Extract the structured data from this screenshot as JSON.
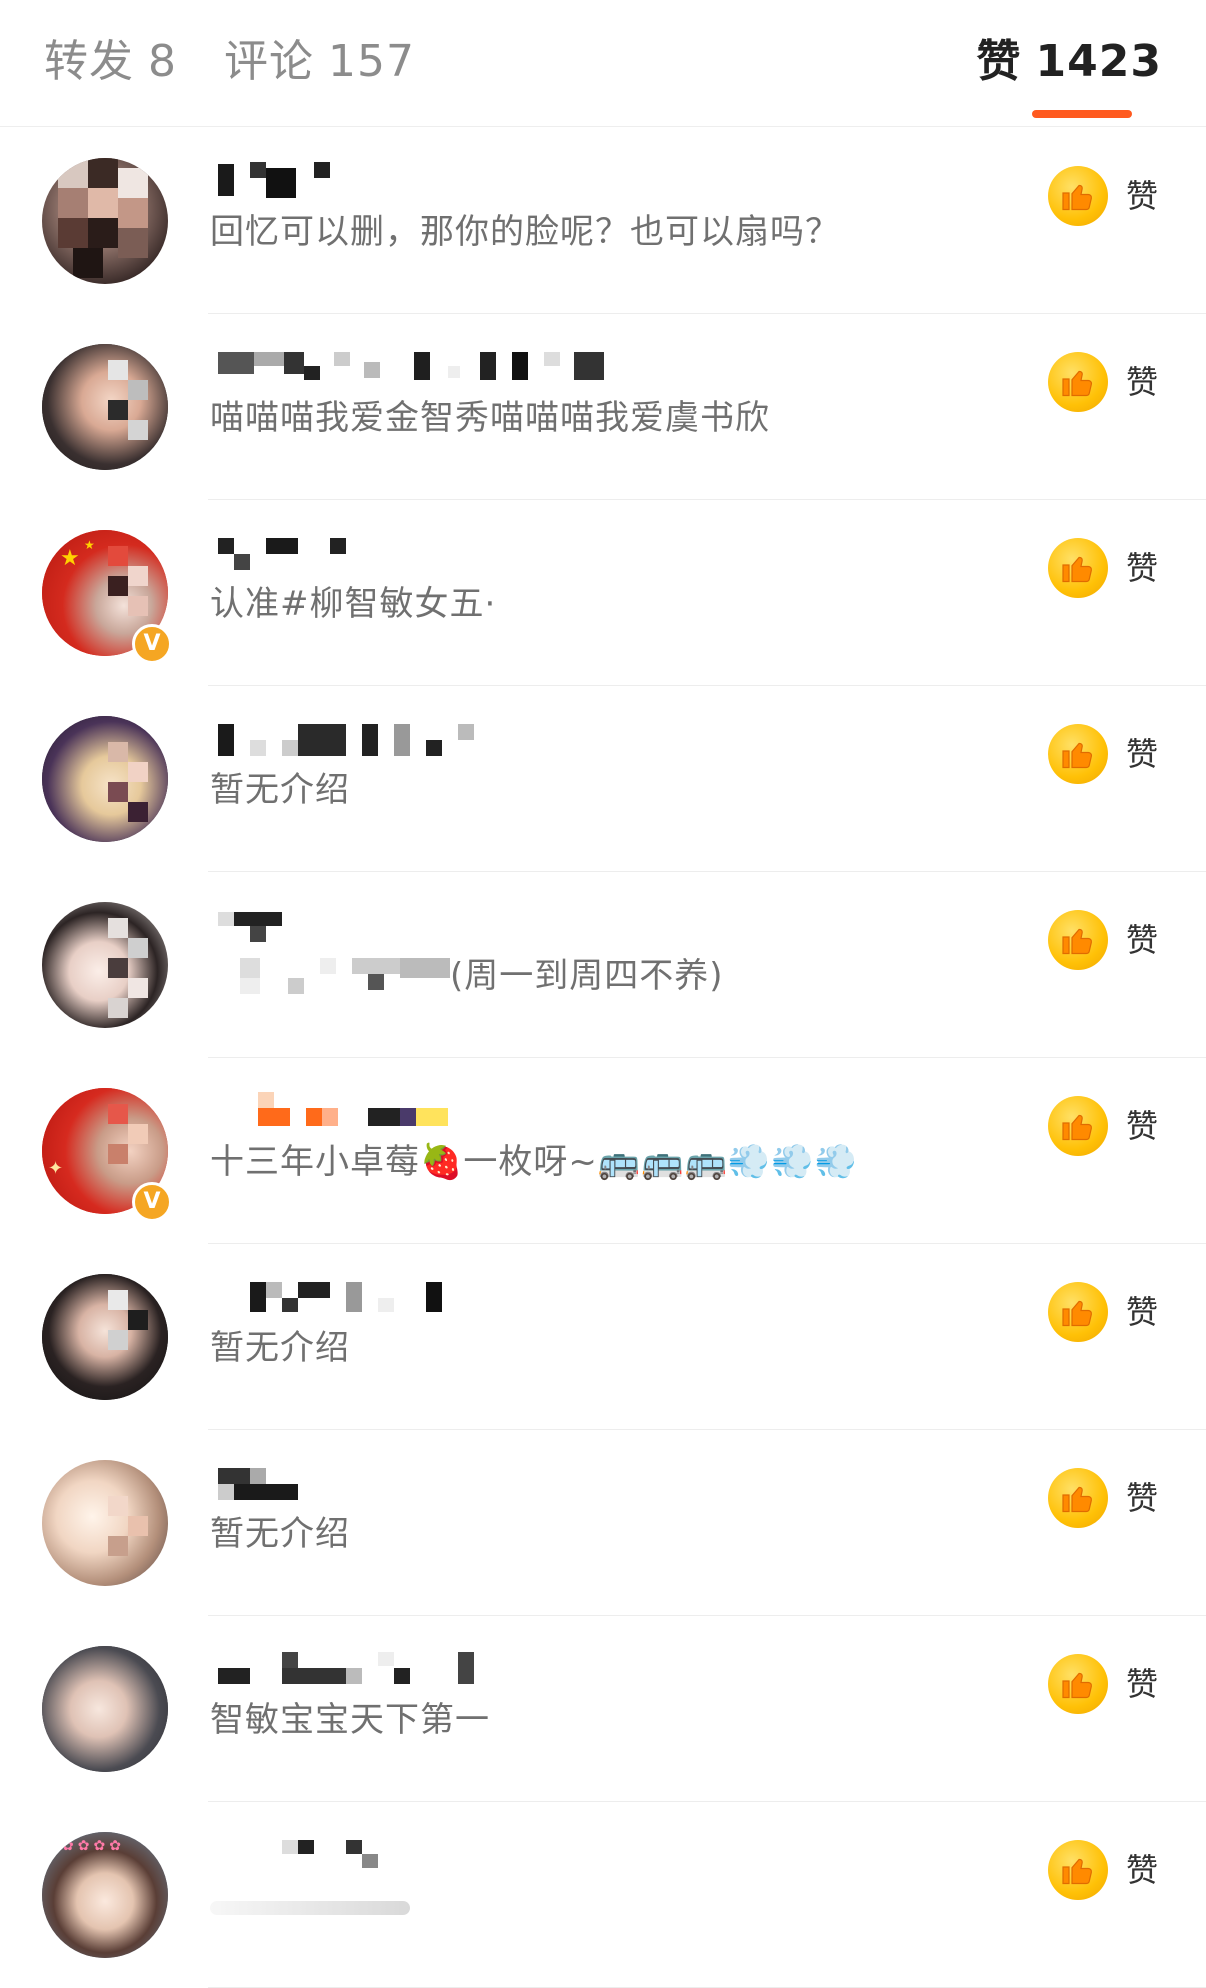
{
  "tabs": {
    "repost_label": "转发",
    "repost_count": "8",
    "comment_label": "评论",
    "comment_count": "157",
    "like_label": "赞",
    "like_count": "1423",
    "active_tab": "like",
    "indicator_color": "#ff5a1f"
  },
  "like_button_label": "赞",
  "icon_names": {
    "like": "thumbs-up-icon",
    "verified": "verified-badge-icon"
  },
  "colors": {
    "like_button": "#ffc107",
    "verified_badge": "#f5a623",
    "comment_text": "#707070"
  },
  "users": [
    {
      "comment": "回忆可以删，那你的脸呢？也可以扇吗？",
      "verified": false
    },
    {
      "comment": "喵喵喵我爱金智秀喵喵喵我爱虞书欣",
      "verified": false
    },
    {
      "comment": "认准#柳智敏女五·",
      "verified": true
    },
    {
      "comment": "暂无介绍",
      "verified": false
    },
    {
      "comment": "(周一到周四不养)",
      "verified": false
    },
    {
      "comment": "十三年小卓莓🍓一枚呀~🚌🚌🚌💨💨💨",
      "verified": true
    },
    {
      "comment": "暂无介绍",
      "verified": false
    },
    {
      "comment": "暂无介绍",
      "verified": false
    },
    {
      "comment": "智敏宝宝天下第一",
      "verified": false
    },
    {
      "comment": "",
      "verified": false
    }
  ]
}
